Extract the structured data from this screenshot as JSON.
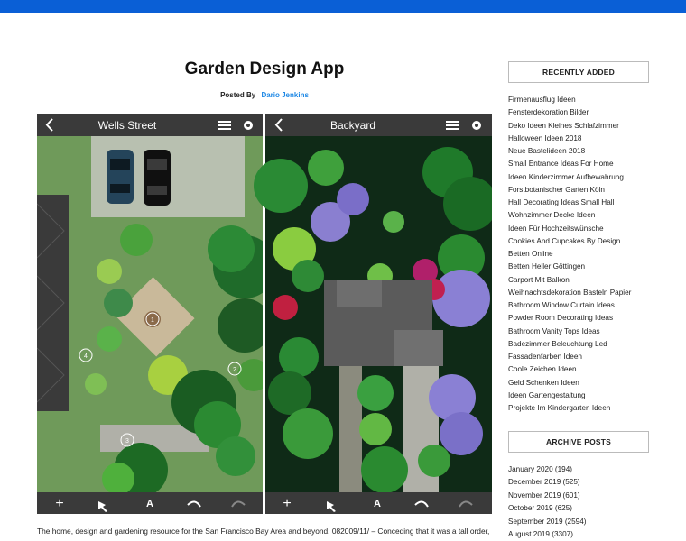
{
  "post": {
    "title": "Garden Design App",
    "posted_by_label": "Posted By",
    "author": "Dario Jenkins",
    "excerpt": "The home, design and gardening resource for the San Francisco Bay Area and beyond. 082009/11/ – Conceding that it was a tall order,"
  },
  "image": {
    "left_panel": {
      "title": "Wells Street",
      "markers": [
        "1",
        "4",
        "2",
        "3"
      ]
    },
    "right_panel": {
      "title": "Backyard"
    },
    "toolbar_glyphs": {
      "text_tool": "A"
    }
  },
  "sidebar": {
    "recent_title": "RECENTLY ADDED",
    "recent_items": [
      "Firmenausflug Ideen",
      "Fensterdekoration Bilder",
      "Deko Ideen Kleines Schlafzimmer",
      "Halloween Ideen 2018",
      "Neue Bastelideen 2018",
      "Small Entrance Ideas For Home",
      "Ideen Kinderzimmer Aufbewahrung",
      "Forstbotanischer Garten Köln",
      "Hall Decorating Ideas Small Hall",
      "Wohnzimmer Decke Ideen",
      "Ideen Für Hochzeitswünsche",
      "Cookies And Cupcakes By Design",
      "Betten Online",
      "Betten Heller Göttingen",
      "Carport Mit Balkon",
      "Weihnachtsdekoration Basteln Papier",
      "Bathroom Window Curtain Ideas",
      "Powder Room Decorating Ideas",
      "Bathroom Vanity Tops Ideas",
      "Badezimmer Beleuchtung Led",
      "Fassadenfarben Ideen",
      "Coole Zeichen Ideen",
      "Geld Schenken Ideen",
      "Ideen Gartengestaltung",
      "Projekte Im Kindergarten Ideen"
    ],
    "archive_title": "ARCHIVE POSTS",
    "archive_items": [
      "January 2020 (194)",
      "December 2019 (525)",
      "November 2019 (601)",
      "October 2019 (625)",
      "September 2019 (2594)",
      "August 2019 (3307)"
    ]
  },
  "colors": {
    "topbar": "#0a5fd6",
    "author_link": "#1e88e5",
    "app_header": "#3a3a3a",
    "lawn": "#6f9a5a",
    "backyard": "#0f2a17"
  }
}
